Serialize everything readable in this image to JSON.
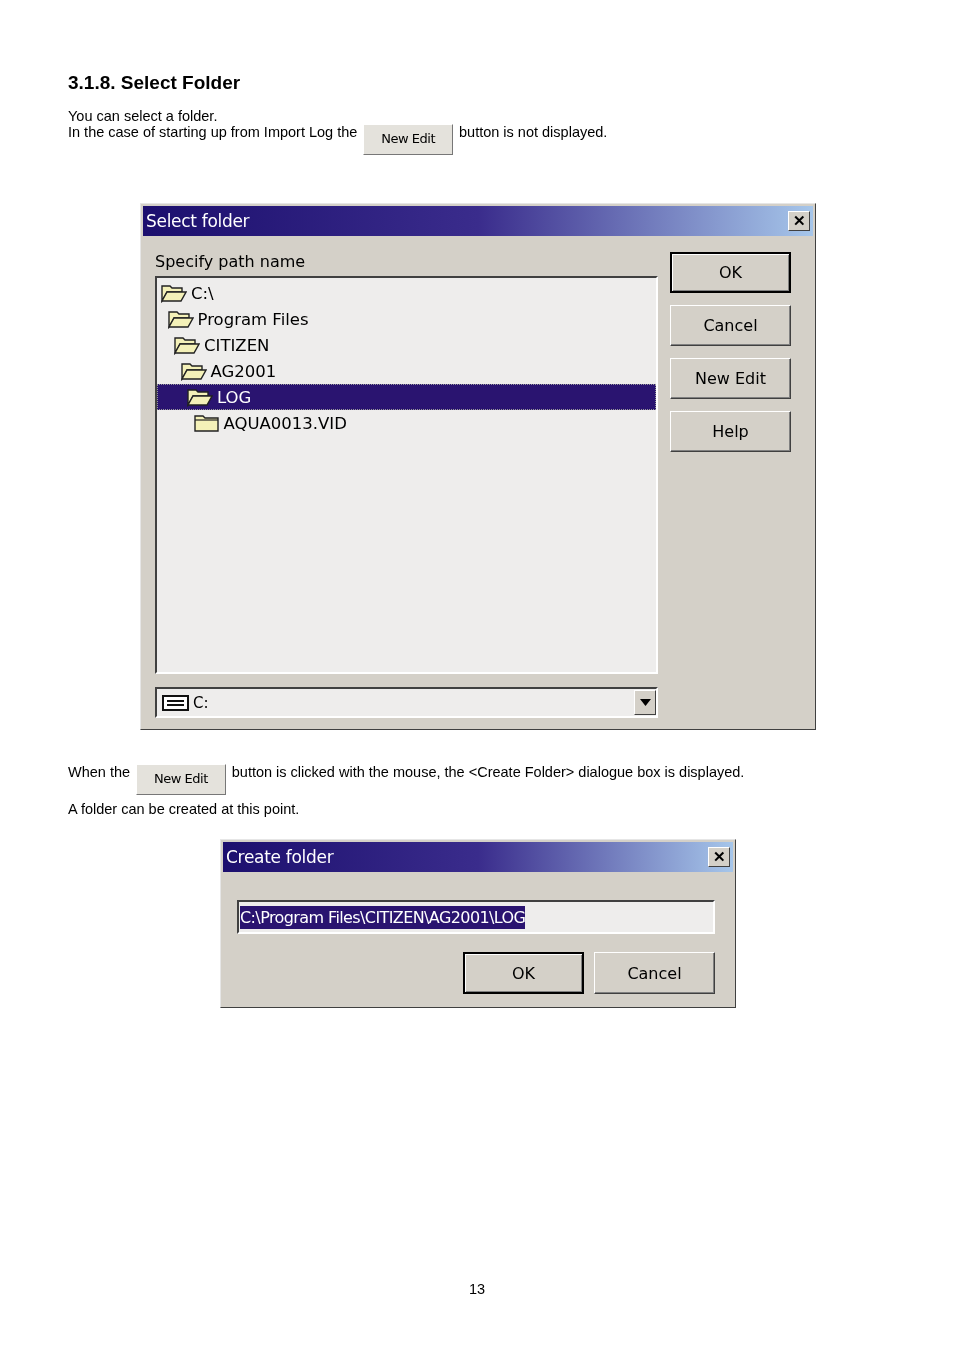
{
  "heading": "3.1.8. Select Folder",
  "intro": {
    "line_1": "You can select a folder.",
    "line_2_before": "In the case of starting up from Import Log the",
    "inline_button": "New Edit",
    "line_2_after": "button is not displayed."
  },
  "select_dialog": {
    "title": "Select folder",
    "close": "✕",
    "label": "Specify path name",
    "tree": [
      {
        "label": "C:\\",
        "open": true,
        "selected": false,
        "children": [
          {
            "label": "Program Files",
            "open": true,
            "selected": false,
            "children": [
              {
                "label": "CITIZEN",
                "open": true,
                "selected": false,
                "children": [
                  {
                    "label": "AG2001",
                    "open": true,
                    "selected": false,
                    "children": [
                      {
                        "label": "LOG",
                        "open": true,
                        "selected": true,
                        "children": [
                          {
                            "label": "AQUA0013.VID",
                            "open": false,
                            "selected": false
                          }
                        ]
                      }
                    ]
                  }
                ]
              }
            ]
          }
        ]
      }
    ],
    "drive": "C:",
    "buttons": [
      {
        "label": "OK",
        "default": true
      },
      {
        "label": "Cancel",
        "default": false
      },
      {
        "label": "New Edit",
        "default": false
      },
      {
        "label": "Help",
        "default": false
      }
    ]
  },
  "middle": {
    "before": "When the",
    "inline_button": "New Edit",
    "after": "button is clicked with the mouse, the <Create Folder> dialogue box is displayed.",
    "line_2": "A folder can be created at this point."
  },
  "create_dialog": {
    "title": "Create folder",
    "close": "✕",
    "path": {
      "value": "C:\\Program Files\\CITIZEN\\AG2001\\LOG",
      "selected": true
    },
    "buttons": [
      {
        "label": "OK",
        "default": true
      },
      {
        "label": "Cancel",
        "default": false
      }
    ]
  },
  "page_number": "13"
}
